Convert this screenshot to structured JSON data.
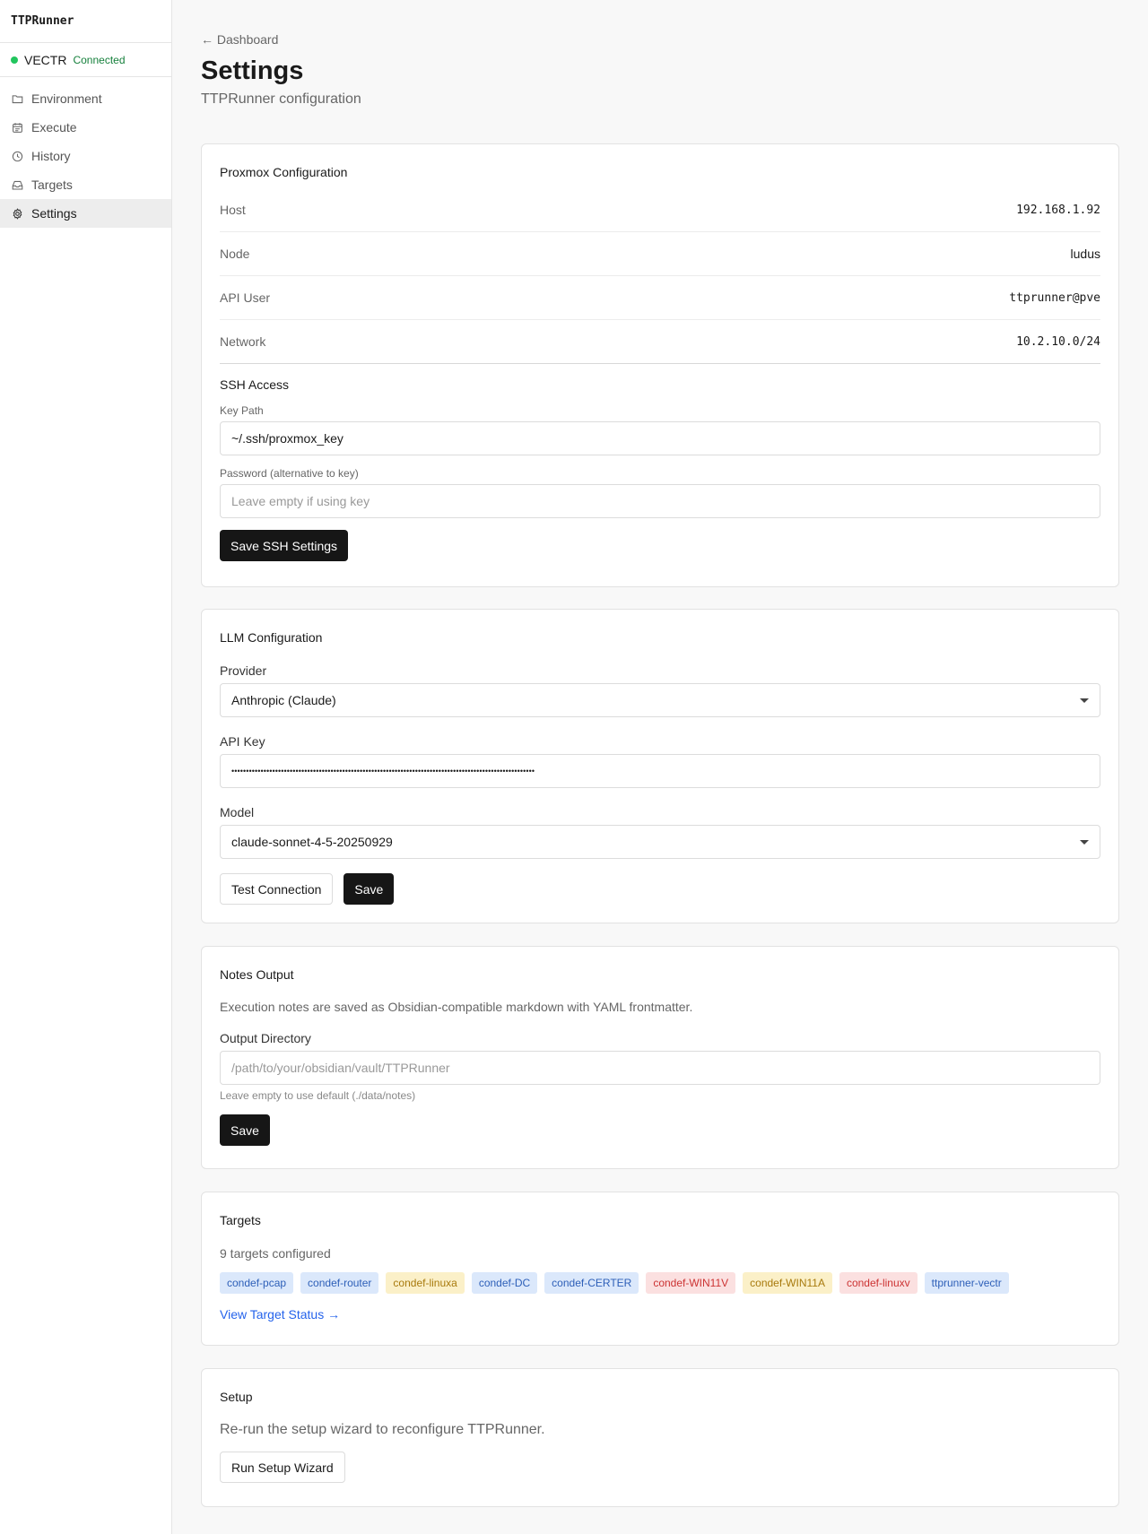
{
  "app": {
    "title": "TTPRunner"
  },
  "connection": {
    "name": "VECTR",
    "status": "Connected"
  },
  "sidebar": {
    "items": [
      {
        "label": "Environment",
        "icon": "folder-icon",
        "active": false
      },
      {
        "label": "Execute",
        "icon": "calendar-icon",
        "active": false
      },
      {
        "label": "History",
        "icon": "clock-icon",
        "active": false
      },
      {
        "label": "Targets",
        "icon": "inbox-icon",
        "active": false
      },
      {
        "label": "Settings",
        "icon": "gear-icon",
        "active": true
      }
    ]
  },
  "breadcrumb": {
    "arrow": "←",
    "label": "Dashboard"
  },
  "page": {
    "title": "Settings",
    "subtitle": "TTPRunner configuration"
  },
  "proxmox": {
    "title": "Proxmox Configuration",
    "rows": [
      {
        "key": "Host",
        "value": "192.168.1.92"
      },
      {
        "key": "Node",
        "value": "ludus"
      },
      {
        "key": "API User",
        "value": "ttprunner@pve"
      },
      {
        "key": "Network",
        "value": "10.2.10.0/24"
      }
    ],
    "ssh": {
      "title": "SSH Access",
      "key_path_label": "Key Path",
      "key_path_value": "~/.ssh/proxmox_key",
      "password_label": "Password (alternative to key)",
      "password_placeholder": "Leave empty if using key",
      "save_label": "Save SSH Settings"
    }
  },
  "llm": {
    "title": "LLM Configuration",
    "provider_label": "Provider",
    "provider_value": "Anthropic (Claude)",
    "api_key_label": "API Key",
    "api_key_value": "••••••••••••••••••••••••••••••••••••••••••••••••••••••••••••••••••••••••••••••••••••••••••••••••••••••••",
    "model_label": "Model",
    "model_value": "claude-sonnet-4-5-20250929",
    "test_label": "Test Connection",
    "save_label": "Save"
  },
  "notes": {
    "title": "Notes Output",
    "description": "Execution notes are saved as Obsidian-compatible markdown with YAML frontmatter.",
    "dir_label": "Output Directory",
    "dir_placeholder": "/path/to/your/obsidian/vault/TTPRunner",
    "hint": "Leave empty to use default (./data/notes)",
    "save_label": "Save"
  },
  "targets": {
    "title": "Targets",
    "count_text": "9 targets configured",
    "tags": [
      {
        "label": "condef-pcap",
        "color": "blue"
      },
      {
        "label": "condef-router",
        "color": "blue"
      },
      {
        "label": "condef-linuxa",
        "color": "yellow"
      },
      {
        "label": "condef-DC",
        "color": "blue"
      },
      {
        "label": "condef-CERTER",
        "color": "blue"
      },
      {
        "label": "condef-WIN11V",
        "color": "red"
      },
      {
        "label": "condef-WIN11A",
        "color": "yellow"
      },
      {
        "label": "condef-linuxv",
        "color": "red"
      },
      {
        "label": "ttprunner-vectr",
        "color": "blue"
      }
    ],
    "link_label": "View Target Status →"
  },
  "setup": {
    "title": "Setup",
    "description": "Re-run the setup wizard to reconfigure TTPRunner.",
    "button_label": "Run Setup Wizard"
  },
  "colors": {
    "accent": "#161616",
    "link": "#2563eb",
    "connected": "#22c55e"
  }
}
